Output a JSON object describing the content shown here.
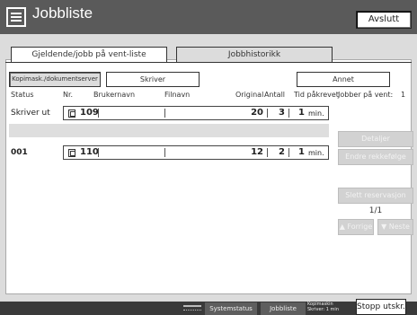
{
  "header": {
    "title": "Jobbliste",
    "exit_label": "Avslutt"
  },
  "tabs": {
    "current": "Gjeldende/jobb på vent-liste",
    "history": "Jobbhistorikk"
  },
  "filters": {
    "copier": "Kopimask./dokumentserver",
    "printer": "Skriver",
    "other": "Annet"
  },
  "columns": {
    "status": "Status",
    "nr": "Nr.",
    "user": "Brukernavn",
    "file": "Filnavn",
    "originals": "Original",
    "count": "Antall",
    "time": "Tid påkrevet",
    "waiting_label": "Jobber på vent:",
    "waiting_count": "1"
  },
  "jobs": [
    {
      "status": "Skriver ut",
      "nr": "109",
      "originals": "20",
      "count": "3",
      "time": "1",
      "unit": "min."
    },
    {
      "status": "001",
      "nr": "110",
      "originals": "12",
      "count": "2",
      "time": "1",
      "unit": "min."
    }
  ],
  "side_buttons": {
    "details": "Detaljer",
    "change_order": "Endre rekkefølge",
    "delete_reservation": "Slett reservasjon",
    "page": "1/1",
    "prev": "▲ Forrige",
    "next": "▼ Neste"
  },
  "footer": {
    "system_status": "Systemstatus",
    "job_list": "Jobbliste",
    "machine_line1": "Kopimaskin",
    "machine_line2": "Skriver: 1 min",
    "stop_print": "Stopp utskr."
  }
}
